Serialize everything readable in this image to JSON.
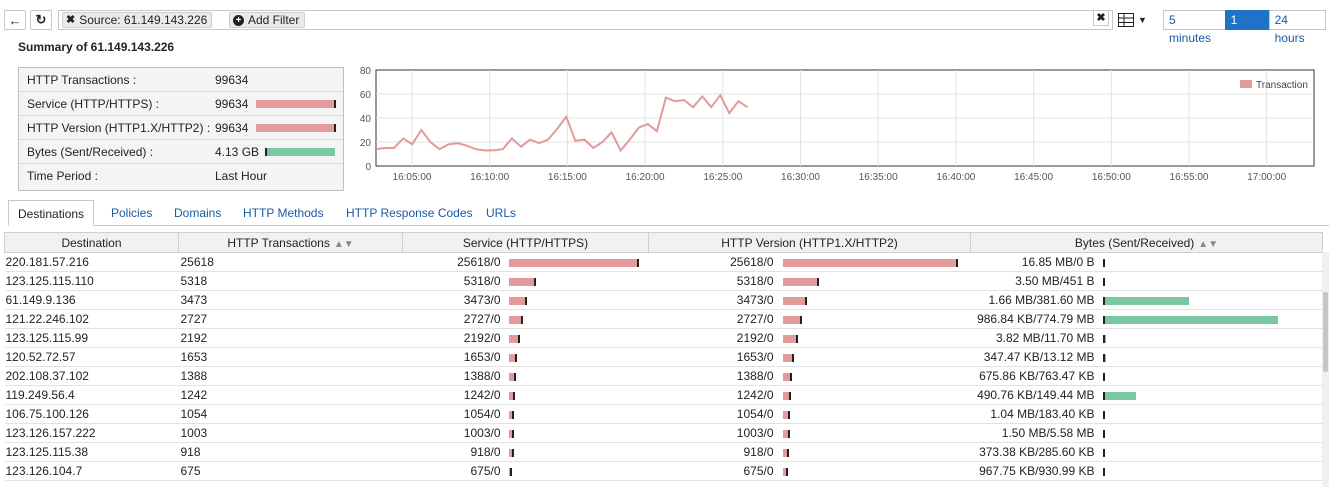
{
  "toolbar": {
    "back_icon": "arrow-left-icon",
    "refresh_icon": "refresh-icon",
    "filter_chip": "Source: 61.149.143.226",
    "add_filter": "Add Filter",
    "time_ranges": [
      "5 minutes",
      "1 hour",
      "24 hours"
    ],
    "active_range": "1 hour"
  },
  "summary": {
    "title": "Summary of 61.149.143.226",
    "rows": [
      {
        "label": "HTTP Transactions :",
        "value": "99634"
      },
      {
        "label": "Service (HTTP/HTTPS) :",
        "value": "99634"
      },
      {
        "label": "HTTP Version (HTTP1.X/HTTP2) :",
        "value": "99634"
      },
      {
        "label": "Bytes (Sent/Received) :",
        "value": "4.13 GB"
      },
      {
        "label": "Time Period :",
        "value": "Last Hour"
      }
    ]
  },
  "chart_data": {
    "type": "line",
    "series": [
      {
        "name": "Transaction",
        "color": "#e39a9a",
        "values": [
          14,
          15,
          15,
          23,
          18,
          30,
          20,
          14,
          18,
          19,
          17,
          14,
          13,
          13,
          14,
          23,
          16,
          22,
          19,
          22,
          31,
          41,
          21,
          22,
          15,
          20,
          28,
          13,
          22,
          32,
          35,
          29,
          57,
          54,
          55,
          49,
          58,
          49,
          59,
          44,
          54,
          49
        ]
      }
    ],
    "x_ticks": [
      "16:05:00",
      "16:10:00",
      "16:15:00",
      "16:20:00",
      "16:25:00",
      "16:30:00",
      "16:35:00",
      "16:40:00",
      "16:45:00",
      "16:50:00",
      "16:55:00",
      "17:00:00"
    ],
    "y_ticks": [
      "0",
      "20",
      "40",
      "60",
      "80"
    ],
    "ylim": [
      0,
      80
    ],
    "grid": true,
    "legend": "top-right"
  },
  "tabs": [
    "Destinations",
    "Policies",
    "Domains",
    "HTTP Methods",
    "HTTP Response Codes",
    "URLs"
  ],
  "table": {
    "headers": [
      "Destination",
      "HTTP Transactions",
      "Service (HTTP/HTTPS)",
      "HTTP Version (HTTP1.X/HTTP2)",
      "Bytes (Sent/Received)"
    ],
    "rows": [
      {
        "dest": "220.181.57.216",
        "tx": "25618",
        "svc": "25618/0",
        "ver": "25618/0",
        "bytes": "16.85 MB/0 B",
        "svc_frac": 1.0,
        "byte_frac": 0.0
      },
      {
        "dest": "123.125.115.110",
        "tx": "5318",
        "svc": "5318/0",
        "ver": "5318/0",
        "bytes": "3.50 MB/451 B",
        "svc_frac": 0.2076,
        "byte_frac": 0.0
      },
      {
        "dest": "61.149.9.136",
        "tx": "3473",
        "svc": "3473/0",
        "ver": "3473/0",
        "bytes": "1.66 MB/381.60 MB",
        "svc_frac": 0.1356,
        "byte_frac": 0.49
      },
      {
        "dest": "121.22.246.102",
        "tx": "2727",
        "svc": "2727/0",
        "ver": "2727/0",
        "bytes": "986.84 KB/774.79 MB",
        "svc_frac": 0.1064,
        "byte_frac": 1.0
      },
      {
        "dest": "123.125.115.99",
        "tx": "2192",
        "svc": "2192/0",
        "ver": "2192/0",
        "bytes": "3.82 MB/11.70 MB",
        "svc_frac": 0.0856,
        "byte_frac": 0.015
      },
      {
        "dest": "120.52.72.57",
        "tx": "1653",
        "svc": "1653/0",
        "ver": "1653/0",
        "bytes": "347.47 KB/13.12 MB",
        "svc_frac": 0.0645,
        "byte_frac": 0.017
      },
      {
        "dest": "202.108.37.102",
        "tx": "1388",
        "svc": "1388/0",
        "ver": "1388/0",
        "bytes": "675.86 KB/763.47 KB",
        "svc_frac": 0.0542,
        "byte_frac": 0.0
      },
      {
        "dest": "119.249.56.4",
        "tx": "1242",
        "svc": "1242/0",
        "ver": "1242/0",
        "bytes": "490.76 KB/149.44 MB",
        "svc_frac": 0.0485,
        "byte_frac": 0.19
      },
      {
        "dest": "106.75.100.126",
        "tx": "1054",
        "svc": "1054/0",
        "ver": "1054/0",
        "bytes": "1.04 MB/183.40 KB",
        "svc_frac": 0.0411,
        "byte_frac": 0.0
      },
      {
        "dest": "123.126.157.222",
        "tx": "1003",
        "svc": "1003/0",
        "ver": "1003/0",
        "bytes": "1.50 MB/5.58 MB",
        "svc_frac": 0.0392,
        "byte_frac": 0.007
      },
      {
        "dest": "123.125.115.38",
        "tx": "918",
        "svc": "918/0",
        "ver": "918/0",
        "bytes": "373.38 KB/285.60 KB",
        "svc_frac": 0.0358,
        "byte_frac": 0.0
      },
      {
        "dest": "123.126.104.7",
        "tx": "675",
        "svc": "675/0",
        "ver": "675/0",
        "bytes": "967.75 KB/930.99 KB",
        "svc_frac": 0.0263,
        "byte_frac": 0.0
      }
    ]
  },
  "colors": {
    "accent": "#1f73c6",
    "link": "#1a5aa6",
    "bar_red": "#e39a9a",
    "bar_green": "#7ac7a3"
  }
}
